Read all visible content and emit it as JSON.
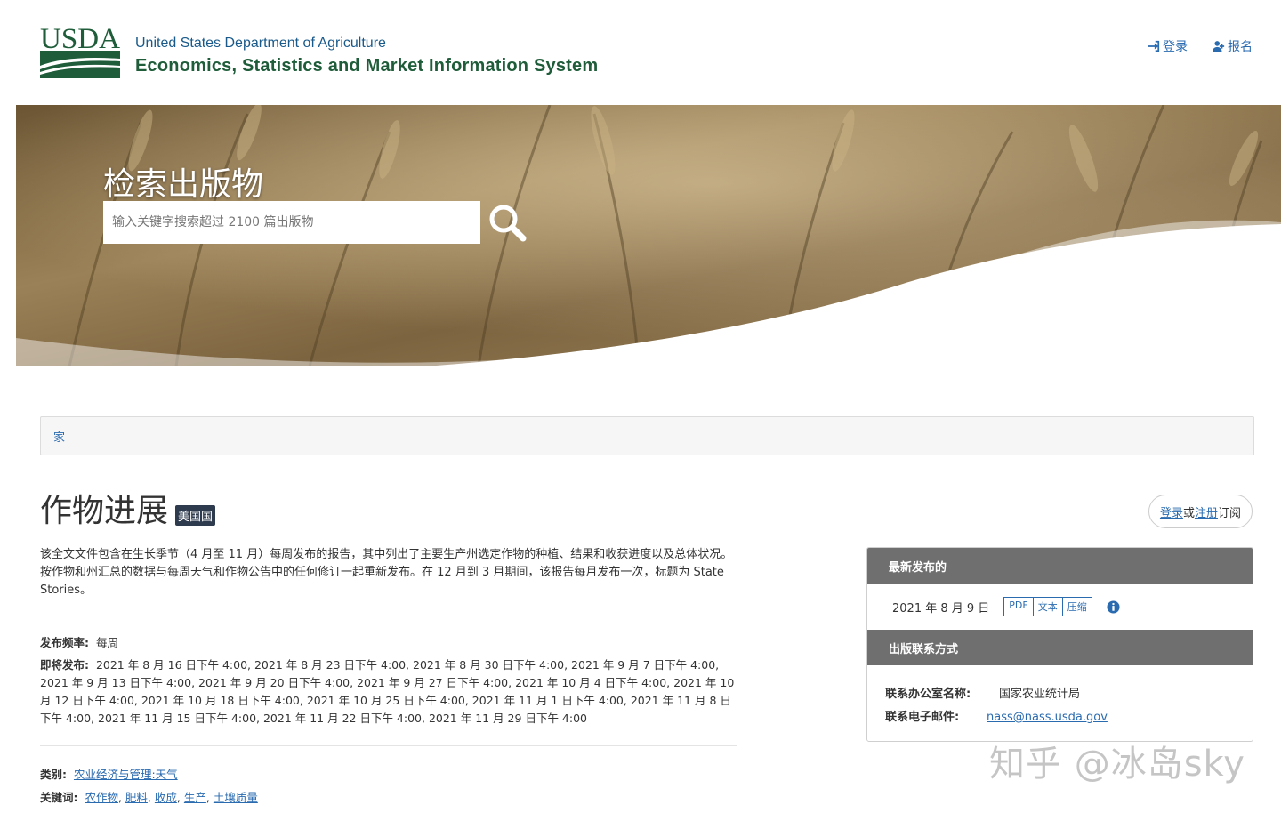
{
  "header": {
    "logo_text": "USDA",
    "agency_line1": "United States Department of Agriculture",
    "agency_line2": "Economics, Statistics and Market Information System",
    "login_label": "登录",
    "register_label": "报名"
  },
  "hero": {
    "title": "检索出版物",
    "search_placeholder": "输入关键字搜索超过 2100 篇出版物"
  },
  "breadcrumb": {
    "home": "家"
  },
  "publication": {
    "title": "作物进展",
    "badge": "美国国",
    "description": "该全文文件包含在生长季节（4 月至 11 月）每周发布的报告，其中列出了主要生产州选定作物的种植、结果和收获进度以及总体状况。按作物和州汇总的数据与每周天气和作物公告中的任何修订一起重新发布。在 12 月到 3 月期间，该报告每月发布一次，标题为 State Stories。",
    "frequency_label": "发布频率:",
    "frequency_value": "每周",
    "upcoming_label": "即将发布:",
    "upcoming_value": "2021 年 8 月 16 日下午 4:00, 2021 年 8 月 23 日下午 4:00, 2021 年 8 月 30 日下午 4:00, 2021 年 9 月 7 日下午 4:00, 2021 年 9 月 13 日下午 4:00, 2021 年 9 月 20 日下午 4:00, 2021 年 9 月 27 日下午 4:00, 2021 年 10 月 4 日下午 4:00, 2021 年 10 月 12 日下午 4:00, 2021 年 10 月 18 日下午 4:00, 2021 年 10 月 25 日下午 4:00, 2021 年 11 月 1 日下午 4:00, 2021 年 11 月 8 日下午 4:00, 2021 年 11 月 15 日下午 4:00, 2021 年 11 月 22 日下午 4:00, 2021 年 11 月 29 日下午 4:00",
    "category_label": "类别:",
    "category_value": "农业经济与管理:天气",
    "keywords_label": "关键词:",
    "keywords": [
      "农作物",
      "肥料",
      "收成",
      "生产",
      "土壤质量"
    ]
  },
  "subscribe": {
    "login": "登录",
    "or": "或",
    "register": "注册",
    "suffix": "订阅"
  },
  "panel": {
    "latest_title": "最新发布的",
    "release_date": "2021 年 8 月 9 日",
    "formats": [
      "PDF",
      "文本",
      "压缩"
    ],
    "contact_title": "出版联系方式",
    "office_label": "联系办公室名称:",
    "office_value": "国家农业统计局",
    "email_label": "联系电子邮件:",
    "email_value": "nass@nass.usda.gov"
  },
  "watermark": "知乎 @冰岛sky",
  "colors": {
    "brand_green": "#1f5d3a",
    "link_blue": "#2a6bb0",
    "panel_gray": "#6f6f6f",
    "badge": "#2e3a4d"
  }
}
